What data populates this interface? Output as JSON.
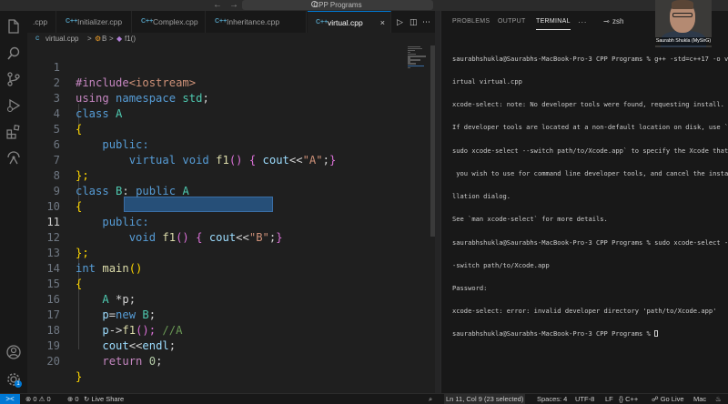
{
  "window": {
    "title": "CPP Programs"
  },
  "tabs": [
    {
      "label": ".cpp",
      "icon": "C++",
      "active": false
    },
    {
      "label": "Initializer.cpp",
      "icon": "C++",
      "active": false
    },
    {
      "label": "Complex.cpp",
      "icon": "C++",
      "active": false
    },
    {
      "label": "Inheritance.cpp",
      "icon": "C++",
      "active": false
    },
    {
      "label": "virtual.cpp",
      "icon": "C++",
      "active": true
    }
  ],
  "breadcrumb": {
    "file": "virtual.cpp",
    "sep": ">",
    "class_name": "B",
    "method": "f1()"
  },
  "editor": {
    "current_line": 11,
    "line_numbers": [
      "1",
      "2",
      "3",
      "4",
      "5",
      "6",
      "7",
      "8",
      "9",
      "10",
      "11",
      "12",
      "13",
      "14",
      "15",
      "16",
      "17",
      "18",
      "19",
      "20"
    ],
    "lines": {
      "l1": {
        "directive": "#include",
        "header": "<iostream>"
      },
      "l2": {
        "using": "using",
        "namespace": "namespace",
        "name": "std",
        "end": ";"
      },
      "l3": {
        "kw": "class",
        "name": "A"
      },
      "l4": {
        "brace": "{"
      },
      "l5": {
        "access": "public:"
      },
      "l6": {
        "kw1": "virtual",
        "kw2": "void",
        "fn": "f1",
        "parens": "()",
        "ob": "{",
        "stream": "cout",
        "op": "<<",
        "str": "\"A\"",
        "semi": ";",
        "cb": "}"
      },
      "l7": {
        "brace": "};"
      },
      "l8": {
        "kw": "class",
        "name": "B",
        "colon": ":",
        "access": "public",
        "base": "A"
      },
      "l9": {
        "brace": "{"
      },
      "l10": {
        "access": "public:"
      },
      "l11": {
        "kw": "void",
        "fn": "f1",
        "parens": "()",
        "ob": "{",
        "stream": "cout",
        "op": "<<",
        "str": "\"B\"",
        "semi": ";",
        "cb": "}"
      },
      "l12": {
        "brace": "};"
      },
      "l13": {
        "kw": "int",
        "fn": "main",
        "parens": "()"
      },
      "l14": {
        "brace": "{"
      },
      "l15": {
        "type": "A",
        "rest": " *p;"
      },
      "l16": {
        "var": "p",
        "eq": "=",
        "kw": "new",
        "type": " B",
        "semi": ";"
      },
      "l17": {
        "var": "p",
        "arrow": "->",
        "fn": "f1",
        "parens": "();",
        "comment": " //A"
      },
      "l18": {
        "stream": "cout",
        "op": "<<",
        "endl": "endl",
        "semi": ";"
      },
      "l19": {
        "kw": "return",
        "num": " 0",
        "semi": ";"
      },
      "l20": {
        "brace": "}"
      }
    }
  },
  "panel": {
    "tabs": [
      "PROBLEMS",
      "OUTPUT",
      "TERMINAL",
      "···"
    ],
    "active_tab": "TERMINAL",
    "terminal_name": "zsh",
    "lines": [
      "saurabhshukla@Saurabhs-MacBook-Pro-3 CPP Programs % g++ -std=c++17 -o v",
      "irtual virtual.cpp",
      "xcode-select: note: No developer tools were found, requesting install.",
      "If developer tools are located at a non-default location on disk, use `",
      "sudo xcode-select --switch path/to/Xcode.app` to specify the Xcode that",
      " you wish to use for command line developer tools, and cancel the insta",
      "llation dialog.",
      "See `man xcode-select` for more details.",
      "saurabhshukla@Saurabhs-MacBook-Pro-3 CPP Programs % sudo xcode-select -",
      "-switch path/to/Xcode.app",
      "Password:",
      "xcode-select: error: invalid developer directory 'path/to/Xcode.app'",
      "saurabhshukla@Saurabhs-MacBook-Pro-3 CPP Programs % "
    ]
  },
  "webcam": {
    "caption": "Saurabh Shukla (MySirG)"
  },
  "statusbar": {
    "remote": "><",
    "errors": "0",
    "warnings": "0",
    "ports": "0",
    "live_share": "Live Share",
    "position": "Ln 11, Col 9 (23 selected)",
    "spaces": "Spaces: 4",
    "encoding": "UTF-8",
    "eol": "LF",
    "language": "C++",
    "go_live": "Go Live",
    "platform": "Mac"
  },
  "colors": {
    "accent": "#0078d4",
    "editor_bg": "#1f1f1f",
    "selection": "#264f78"
  }
}
